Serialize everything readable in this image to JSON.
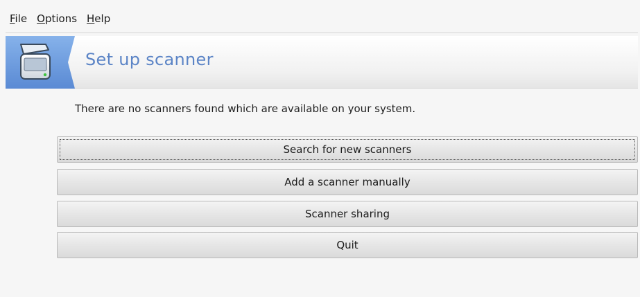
{
  "menubar": {
    "items": [
      {
        "label_first": "F",
        "label_rest": "ile"
      },
      {
        "label_first": "O",
        "label_rest": "ptions"
      },
      {
        "label_first": "H",
        "label_rest": "elp"
      }
    ]
  },
  "banner": {
    "title": "Set up scanner",
    "icon": "scanner-icon",
    "accent_color": "#5b84c6",
    "icon_bg_color": "#6f9ee0"
  },
  "message": "There are no scanners found which are available on your system.",
  "buttons": {
    "search": "Search for new scanners",
    "add": "Add a scanner manually",
    "sharing": "Scanner sharing",
    "quit": "Quit"
  }
}
